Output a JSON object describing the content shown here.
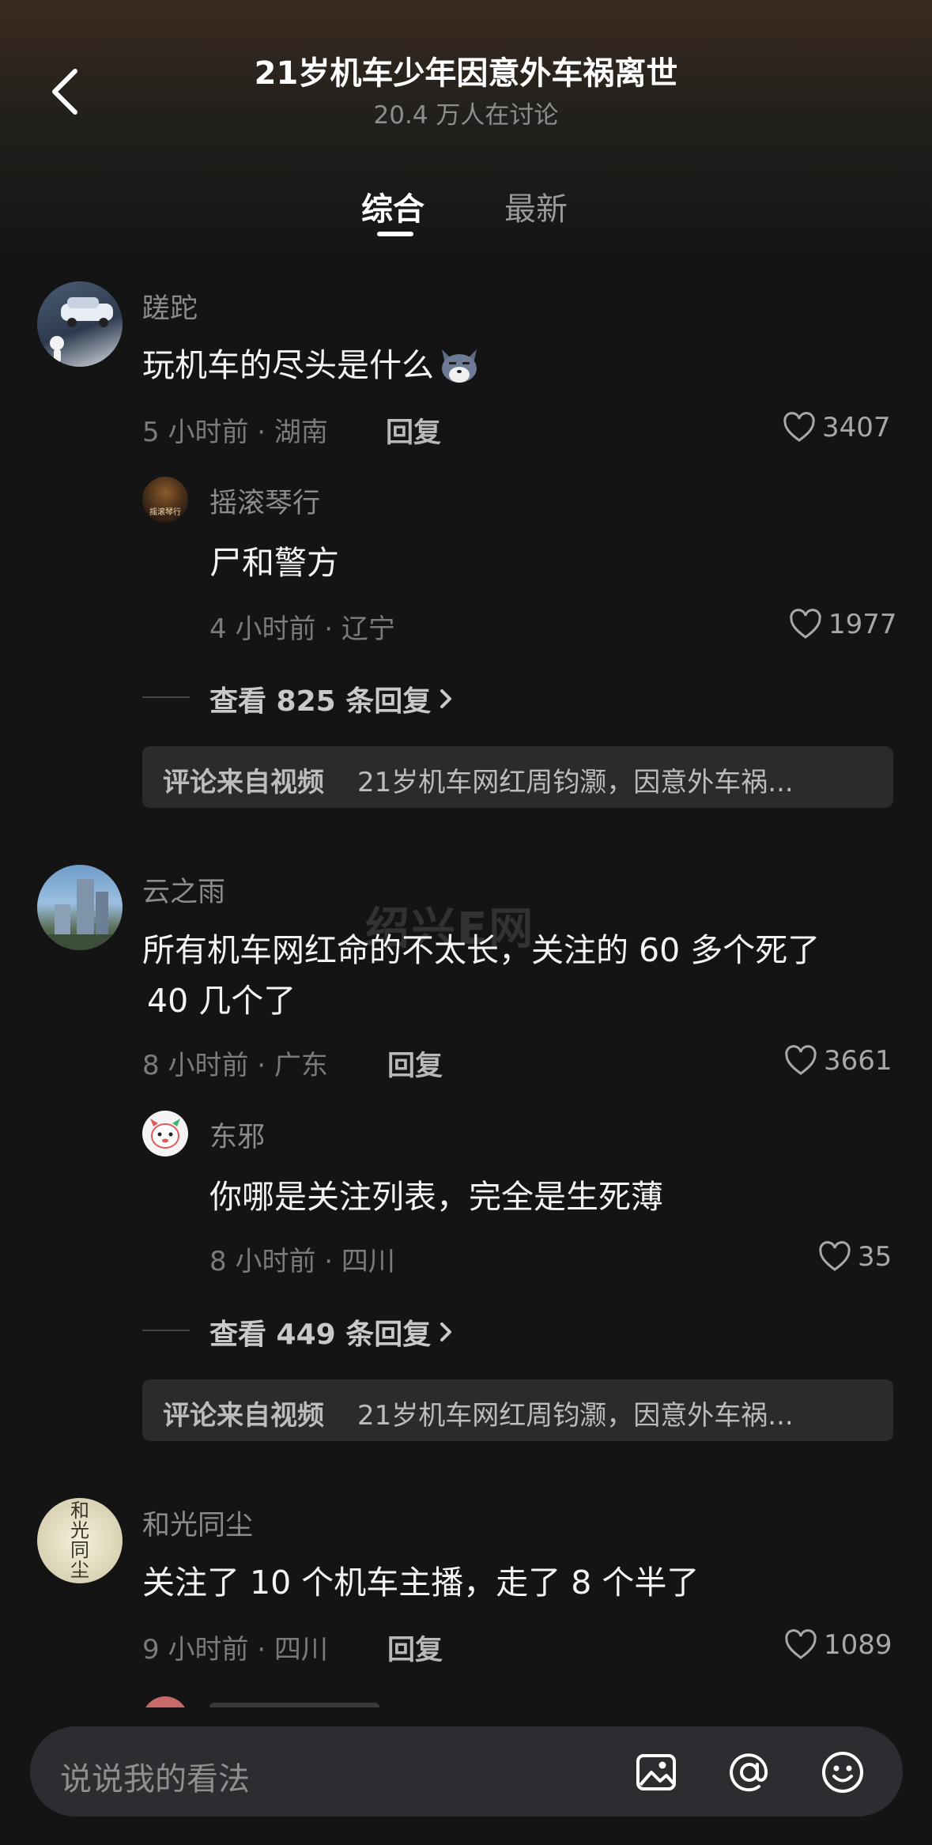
{
  "header": {
    "title": "21岁机车少年因意外车祸离世",
    "subtitle": "20.4 万人在讨论"
  },
  "tabs": [
    {
      "label": "综合",
      "active": true
    },
    {
      "label": "最新",
      "active": false
    }
  ],
  "comments": [
    {
      "author": "蹉跎",
      "text": "玩机车的尽头是什么",
      "emoji": "wolf-emoji-icon",
      "meta": "5 小时前 · 湖南",
      "reply_label": "回复",
      "likes": "3407",
      "reply": {
        "author": "摇滚琴行",
        "avatar_text": "摇滚琴行",
        "text": "尸和警方",
        "meta": "4 小时前 · 辽宁",
        "likes": "1977"
      },
      "expand": "查看 825 条回复",
      "source_label": "评论来自视频",
      "source_text": "21岁机车网红周钧灏，因意外车祸..."
    },
    {
      "author": "云之雨",
      "text_line1": "所有机车网红命的不太长，关注的 60 多个死了",
      "text_line2": "40 几个了",
      "meta": "8 小时前 · 广东",
      "reply_label": "回复",
      "likes": "3661",
      "reply": {
        "author": "东邪",
        "text": "你哪是关注列表，完全是生死薄",
        "meta": "8 小时前 · 四川",
        "likes": "35"
      },
      "expand": "查看 449 条回复",
      "source_label": "评论来自视频",
      "source_text": "21岁机车网红周钧灏，因意外车祸..."
    },
    {
      "author": "和光同尘",
      "avatar_text": "和光同尘",
      "text": "关注了 10 个机车主播，走了 8 个半了",
      "meta": "9 小时前 · 四川",
      "reply_label": "回复",
      "likes": "1089"
    }
  ],
  "watermark": "绍兴E网",
  "input": {
    "placeholder": "说说我的看法"
  },
  "icons": {
    "back": "chevron-left-icon",
    "like": "heart-outline-icon",
    "image": "image-icon",
    "mention": "at-icon",
    "emoji": "smiley-icon"
  },
  "colors": {
    "background": "#141414",
    "header_gradient_top": "#3a2a20",
    "input_bg": "#2b2d30",
    "source_bg": "#2b2b2b"
  }
}
